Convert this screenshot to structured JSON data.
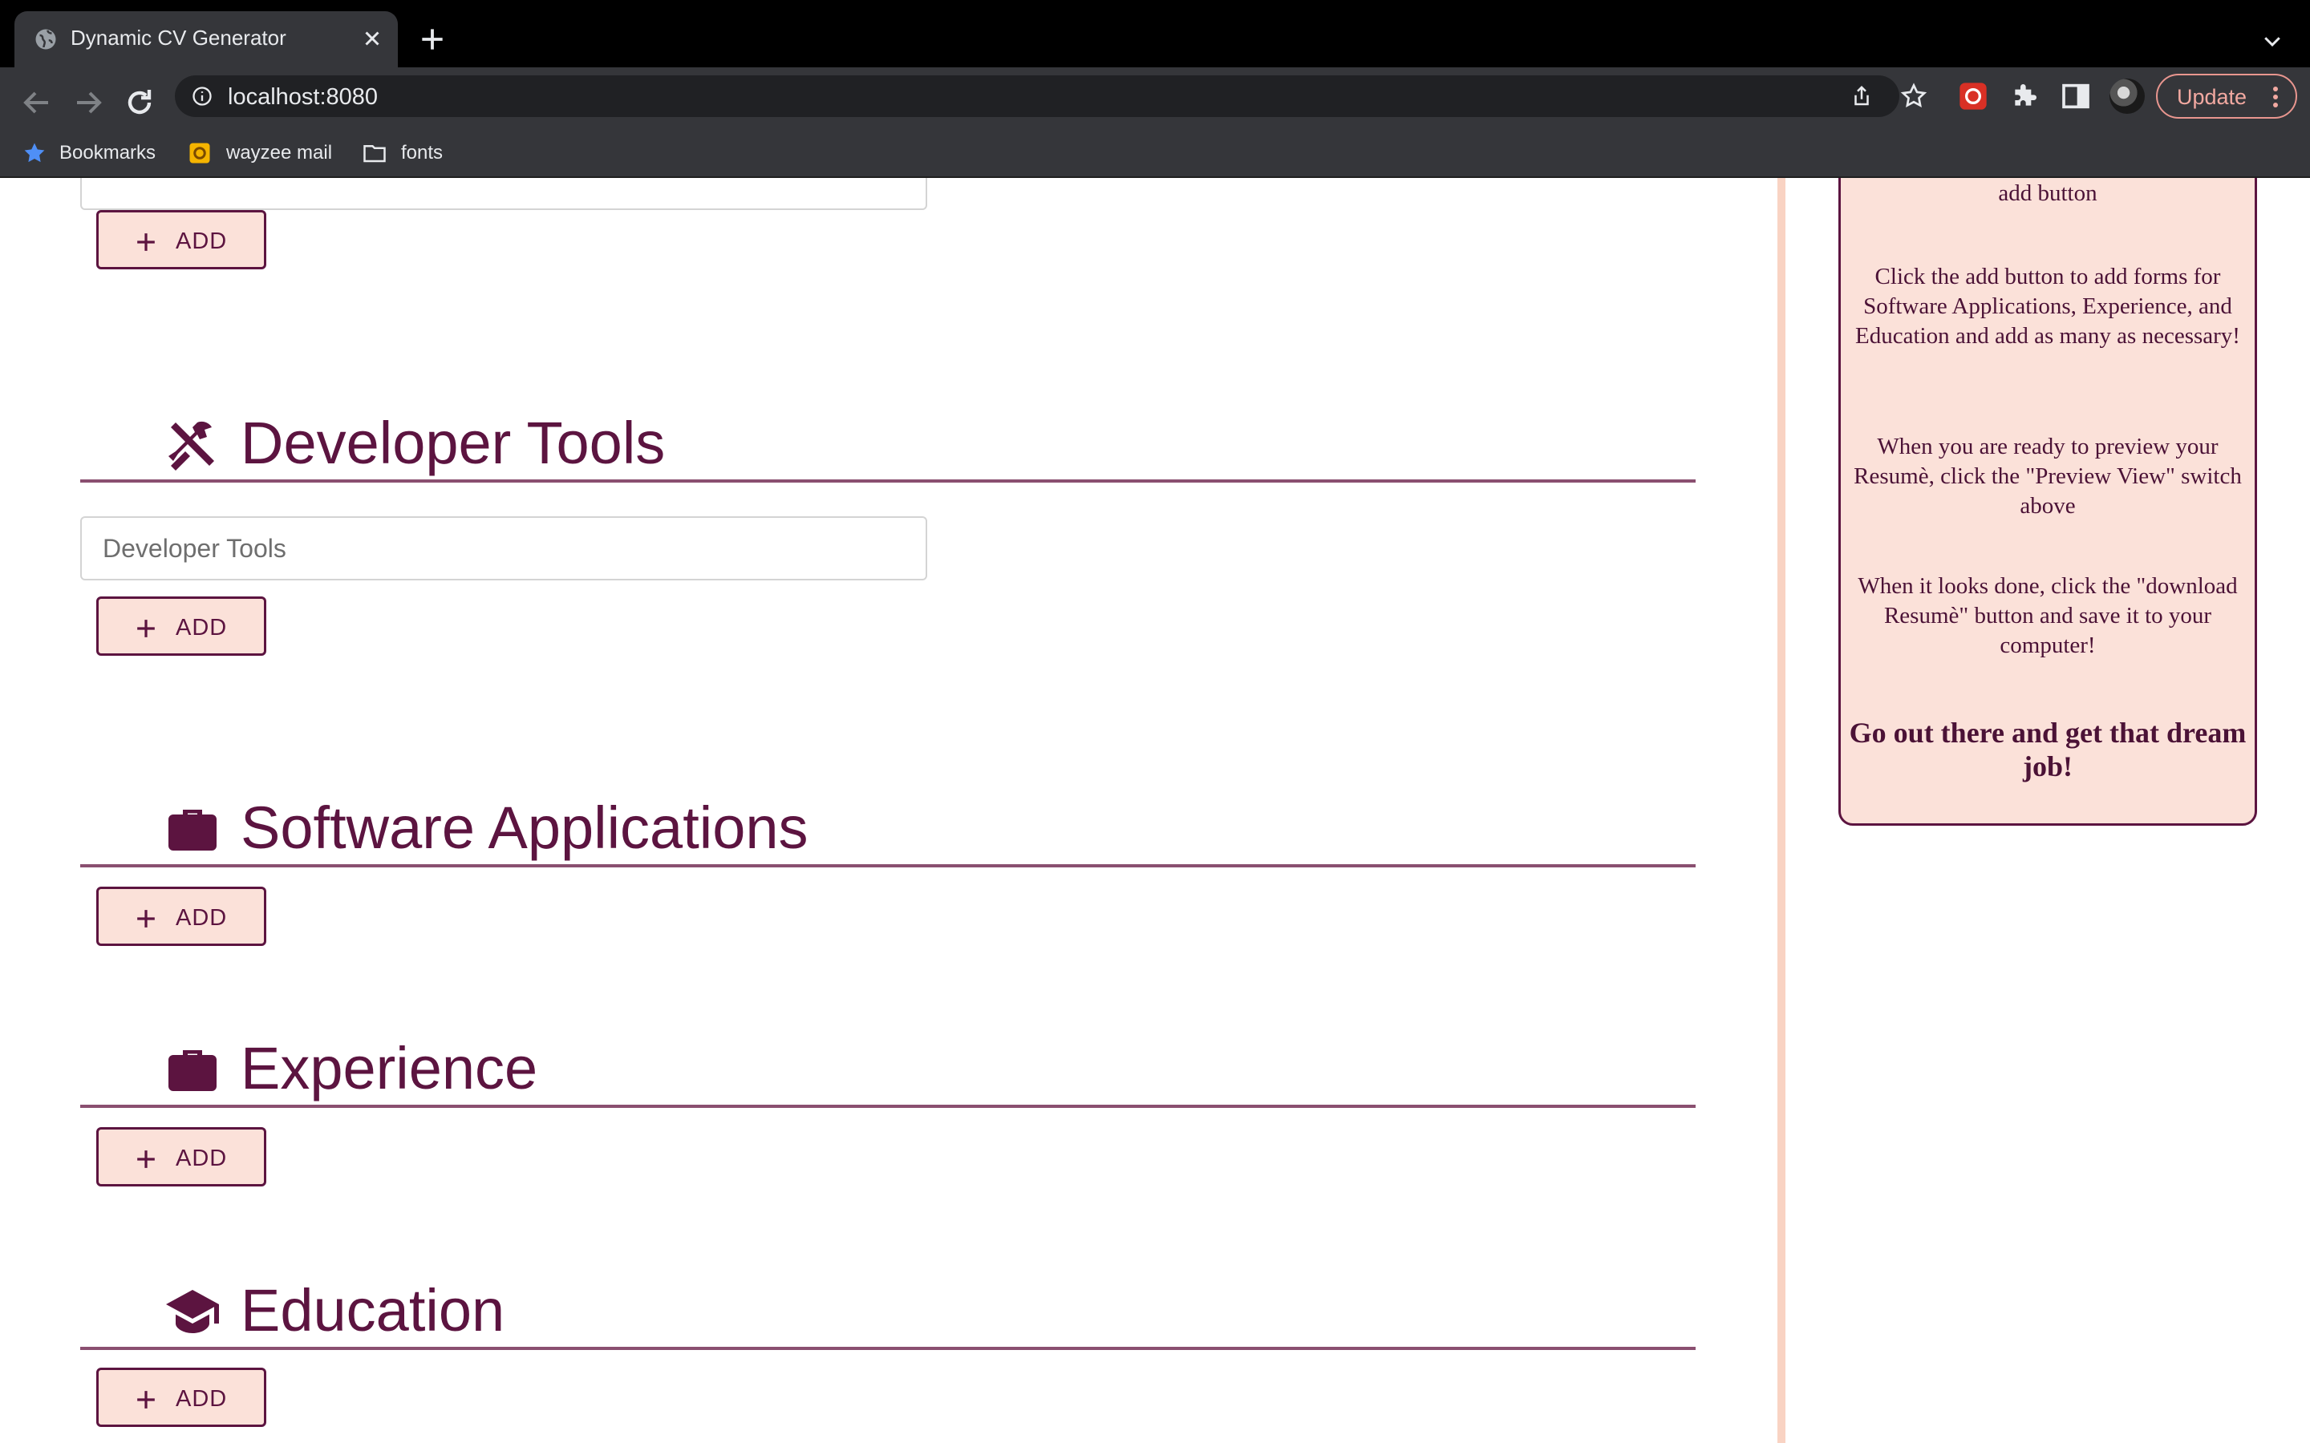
{
  "browser": {
    "tab_title": "Dynamic CV Generator",
    "url": "localhost:8080",
    "update_label": "Update",
    "bookmarks": [
      {
        "label": "Bookmarks",
        "icon": "star-icon"
      },
      {
        "label": "wayzee mail",
        "icon": "mail-icon"
      },
      {
        "label": "fonts",
        "icon": "folder-icon"
      }
    ]
  },
  "page": {
    "colors": {
      "accent": "#5c1440",
      "button_bg": "#fbe1d9",
      "divider": "#f9d3c3"
    },
    "top_add_label": "ADD",
    "sections": [
      {
        "title": "Developer Tools",
        "icon": "tools-icon",
        "input_placeholder": "Developer Tools",
        "add_label": "ADD"
      },
      {
        "title": "Software Applications",
        "icon": "briefcase-icon",
        "add_label": "ADD"
      },
      {
        "title": "Experience",
        "icon": "briefcase-icon",
        "add_label": "ADD"
      },
      {
        "title": "Education",
        "icon": "graduation-cap-icon",
        "add_label": "ADD"
      }
    ]
  },
  "help": {
    "partial": "add button",
    "p1": "Click the add button to add forms for Software Applications, Experience, and Education and add as many as necessary!",
    "p2": "When you are ready to preview your Resumè, click the \"Preview View\" switch above",
    "p3": "When it looks done, click the \"download Resumè\" button and save it to your computer!",
    "p4": "Go out there and get that dream job!"
  }
}
